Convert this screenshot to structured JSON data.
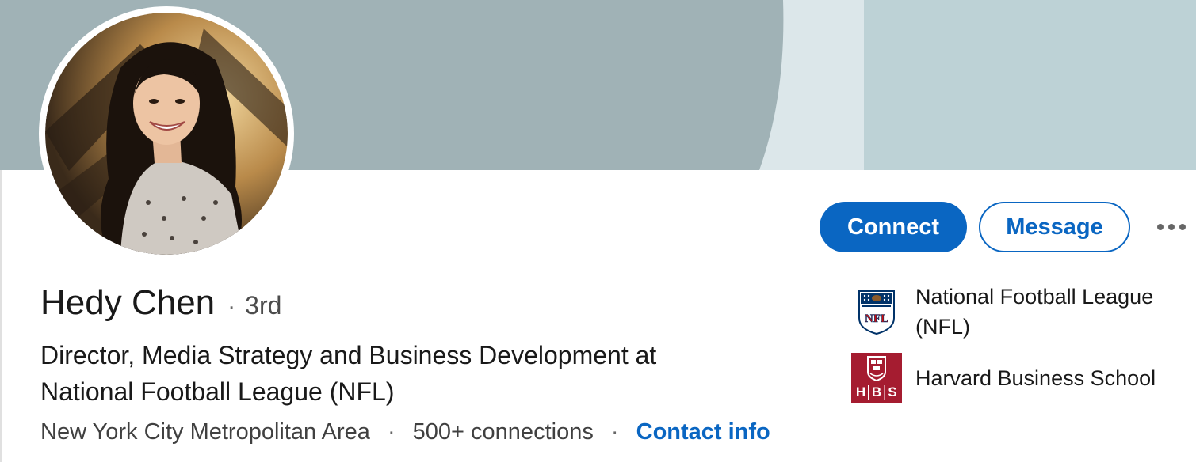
{
  "profile": {
    "name": "Hedy Chen",
    "degree_separator": "·",
    "degree": "3rd",
    "headline": "Director, Media Strategy and Business Development at National Football League (NFL)",
    "location": "New York City Metropolitan Area",
    "meta_separator": "·",
    "connections": "500+ connections",
    "contact_info": "Contact info"
  },
  "actions": {
    "connect_label": "Connect",
    "message_label": "Message",
    "more_icon": "more-horizontal-icon"
  },
  "organizations": [
    {
      "name": "National Football League (NFL)",
      "logo_text": "NFL",
      "logo": "nfl-shield-logo"
    },
    {
      "name": "Harvard Business School",
      "logo_text": [
        "H",
        "B",
        "S"
      ],
      "logo": "hbs-crest-logo"
    }
  ],
  "colors": {
    "accent": "#0a66c2",
    "banner_dark": "#a0b2b6",
    "banner_light": "#dce7ea",
    "banner_right": "#bdd2d6",
    "hbs_red": "#a51c30",
    "nfl_navy": "#013369",
    "nfl_red": "#d50a0a"
  }
}
